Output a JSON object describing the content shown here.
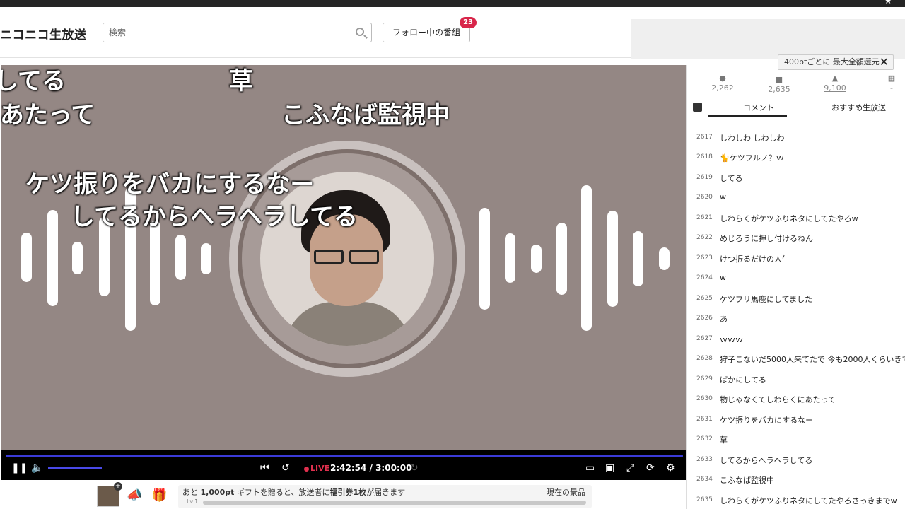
{
  "header": {
    "logo": "ニコニコ生放送",
    "search_placeholder": "検索",
    "follow_label": "フォロー中の番組",
    "follow_count": "23"
  },
  "tooltip": {
    "text": "400ptごとに 最大全額還元"
  },
  "stats": {
    "viewers": "2,262",
    "comments": "2,635",
    "ads": "9,100",
    "gifts": "-"
  },
  "tabs": {
    "comment": "コメント",
    "recommended": "おすすめ生放送"
  },
  "overlay_comments": [
    "してる",
    "草",
    "あたって",
    "こふなば監視中",
    "ケツ振りをバカにするなー",
    "してるからヘラヘラしてる"
  ],
  "player": {
    "live_label": "LIVE",
    "time": "2:42:54 / 3:00:00",
    "volume_level": 0.55
  },
  "footer": {
    "gift_msg_prefix": "あと",
    "gift_msg_pt": "1,000pt",
    "gift_msg_mid": "ギフトを贈ると、放送者に",
    "gift_msg_ticket": "福引券1枚",
    "gift_msg_suffix": "が届きます",
    "level": "Lv.1",
    "prize_link": "現在の景品"
  },
  "comments": [
    {
      "no": "2617",
      "text": "しわしわ しわしわ"
    },
    {
      "no": "2618",
      "text": "🐈ケツフルノ？ｗ"
    },
    {
      "no": "2619",
      "text": "してる"
    },
    {
      "no": "2620",
      "text": "w"
    },
    {
      "no": "2621",
      "text": "しわらくがケツふりネタにしてたやろw"
    },
    {
      "no": "2622",
      "text": "めじろうに押し付けるねん"
    },
    {
      "no": "2623",
      "text": "けつ振るだけの人生"
    },
    {
      "no": "2624",
      "text": "w"
    },
    {
      "no": "2625",
      "text": "ケツフリ馬鹿にしてました"
    },
    {
      "no": "2626",
      "text": "あ"
    },
    {
      "no": "2627",
      "text": "ｗｗｗ"
    },
    {
      "no": "2628",
      "text": "狩子こないだ5000人来てたで 今も2000人くらいきて"
    },
    {
      "no": "2629",
      "text": "ばかにしてる"
    },
    {
      "no": "2630",
      "text": "物じゃなくてしわらくにあたって"
    },
    {
      "no": "2631",
      "text": "ケツ振りをバカにするなー"
    },
    {
      "no": "2632",
      "text": "草"
    },
    {
      "no": "2633",
      "text": "してるからヘラヘラしてる"
    },
    {
      "no": "2634",
      "text": "こふなば監視中"
    },
    {
      "no": "2635",
      "text": "しわらくがケツふりネタにしてたやろさっきまでw"
    }
  ]
}
